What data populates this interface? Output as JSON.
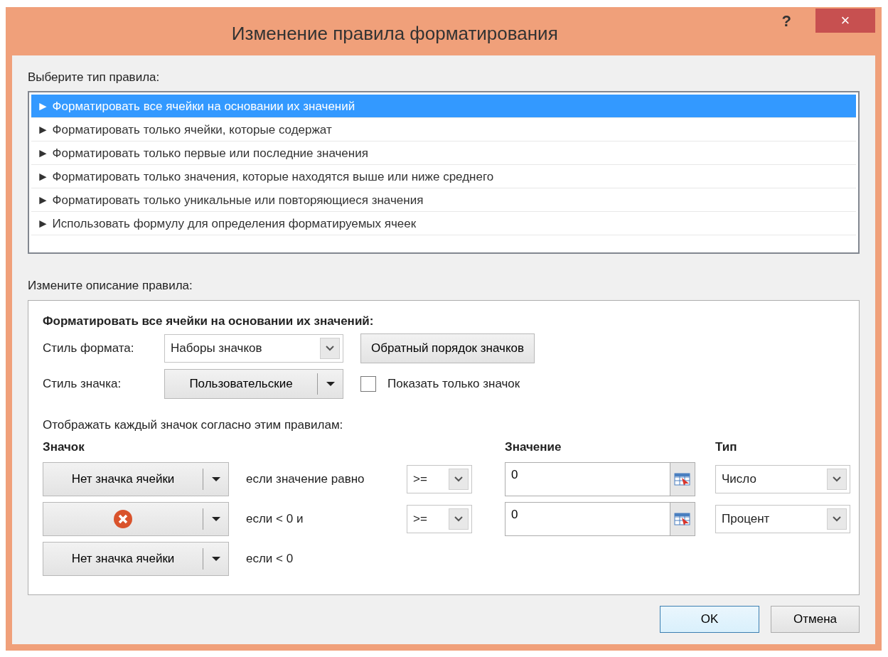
{
  "window": {
    "title": "Изменение правила форматирования",
    "help": "?",
    "close": "×"
  },
  "rule_types": {
    "label": "Выберите тип правила:",
    "items": [
      {
        "text": "► Форматировать все ячейки на основании их значений",
        "selected": true
      },
      {
        "text": "► Форматировать только ячейки, которые содержат",
        "selected": false
      },
      {
        "text": "► Форматировать только первые или последние значения",
        "selected": false
      },
      {
        "text": "► Форматировать только значения, которые находятся выше или ниже среднего",
        "selected": false
      },
      {
        "text": "► Форматировать только уникальные или повторяющиеся значения",
        "selected": false
      },
      {
        "text": "► Использовать формулу для определения форматируемых ячеек",
        "selected": false
      }
    ]
  },
  "description": {
    "label": "Измените описание правила:",
    "heading": "Форматировать все ячейки на основании их значений:",
    "format_style": {
      "label": "Стиль формата:",
      "value": "Наборы значков"
    },
    "reverse_button": "Обратный порядок значков",
    "icon_style": {
      "label": "Стиль значка:",
      "value": "Пользовательские"
    },
    "show_icon_only": {
      "label": "Показать только значок",
      "checked": false
    },
    "rules_label": "Отображать каждый значок согласно этим правилам:",
    "columns": [
      "Значок",
      "Значение",
      "Тип"
    ],
    "rows": [
      {
        "icon": {
          "kind": "text",
          "text": "Нет значка ячейки"
        },
        "condition": "если значение равно",
        "operator": ">=",
        "value": "0",
        "type": "Число"
      },
      {
        "icon": {
          "kind": "cross"
        },
        "condition": "если < 0 и",
        "operator": ">=",
        "value": "0",
        "type": "Процент"
      },
      {
        "icon": {
          "kind": "text",
          "text": "Нет значка ячейки"
        },
        "condition": "если < 0"
      }
    ]
  },
  "buttons": [
    {
      "label": "OK",
      "default": true
    },
    {
      "label": "Отмена",
      "default": false
    }
  ]
}
